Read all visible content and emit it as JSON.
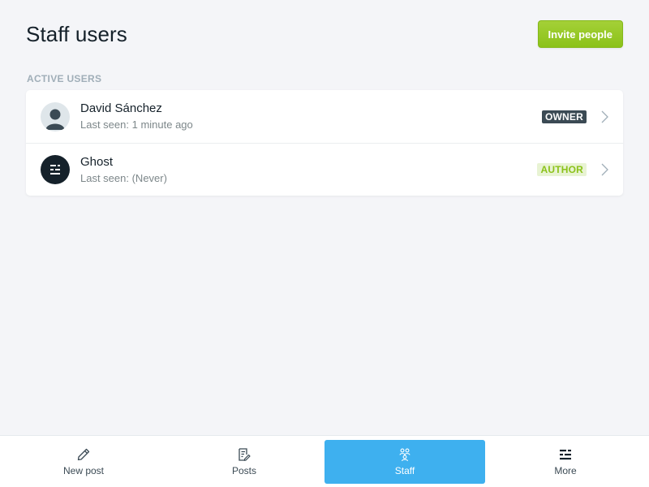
{
  "header": {
    "title": "Staff users",
    "invite_label": "Invite people"
  },
  "section_label": "Active users",
  "users": [
    {
      "name": "David Sánchez",
      "last_seen": "Last seen: 1 minute ago",
      "role": "OWNER",
      "avatar_icon": "user-silhouette-icon"
    },
    {
      "name": "Ghost",
      "last_seen": "Last seen: (Never)",
      "role": "AUTHOR",
      "avatar_icon": "ghost-logo-icon"
    }
  ],
  "nav": {
    "items": [
      {
        "label": "New post",
        "icon": "pencil-icon"
      },
      {
        "label": "Posts",
        "icon": "posts-icon"
      },
      {
        "label": "Staff",
        "icon": "staff-icon",
        "active": true
      },
      {
        "label": "More",
        "icon": "more-icon"
      }
    ]
  },
  "colors": {
    "accent": "#3eb0ef",
    "invite_button": "#8bc219",
    "owner_badge": "#3b4a54",
    "author_badge_text": "#8bc219"
  }
}
